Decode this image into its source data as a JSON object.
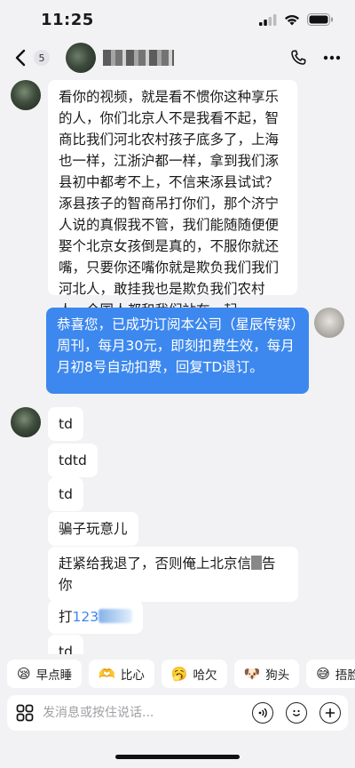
{
  "status_bar": {
    "time": "11:25"
  },
  "nav": {
    "unread_count": "5"
  },
  "messages": [
    {
      "side": "in",
      "text": "看你的视频，就是看不惯你这种享乐的人，你们北京人不是我看不起，智商比我们河北农村孩子底多了，上海也一样，江浙沪都一样，拿到我们涿县初中都考不上，不信来涿县试试？涿县孩子的智商吊打你们，那个济宁人说的真假我不管，我们能随随便便娶个北京女孩倒是真的，不服你就还嘴，只要你还嘴你就是欺负我们我们河北人，敢挂我也是欺负我们农村人，全国人都和我们站在一起"
    },
    {
      "side": "out",
      "text": "恭喜您，已成功订阅本公司（星辰传媒）周刊，每月30元，即刻扣费生效，每月月初8号自动扣费，回复TD退订。"
    },
    {
      "side": "in",
      "text": "td"
    },
    {
      "side": "in",
      "text": "tdtd"
    },
    {
      "side": "in",
      "text": "td"
    },
    {
      "side": "in",
      "text": "骗子玩意儿"
    },
    {
      "side": "in",
      "text_a": "赶紧给我退了，否则俺上北京信",
      "text_b": "告你"
    },
    {
      "side": "in",
      "text_a": "打",
      "text_link": "123"
    },
    {
      "side": "in",
      "text": "td"
    }
  ],
  "quick_replies": [
    {
      "emoji": "😪",
      "label": "早点睡"
    },
    {
      "emoji": "🫶",
      "label": "比心"
    },
    {
      "emoji": "🥱",
      "label": "哈欠"
    },
    {
      "emoji": "🐶",
      "label": "狗头"
    },
    {
      "emoji": "😅",
      "label": "捂脸"
    }
  ],
  "input": {
    "placeholder": "发消息或按住说话..."
  }
}
